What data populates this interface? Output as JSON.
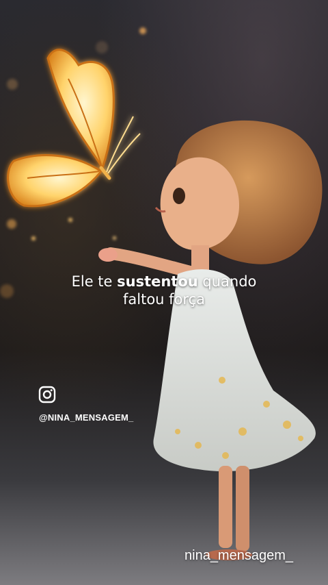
{
  "caption": {
    "part1": "Ele te ",
    "part2_bold": "sustentou",
    "part3": " quando",
    "line2": "faltou força"
  },
  "social": {
    "icon": "instagram-icon",
    "handle": "@NINA_MENSAGEM_"
  },
  "watermark": "nina_mensagem_",
  "colors": {
    "butterfly_glow": "#ffd36b",
    "butterfly_edge": "#d9821c",
    "dress": "#dfe2e0",
    "hair": "#b97a43",
    "text": "#ffffff"
  }
}
